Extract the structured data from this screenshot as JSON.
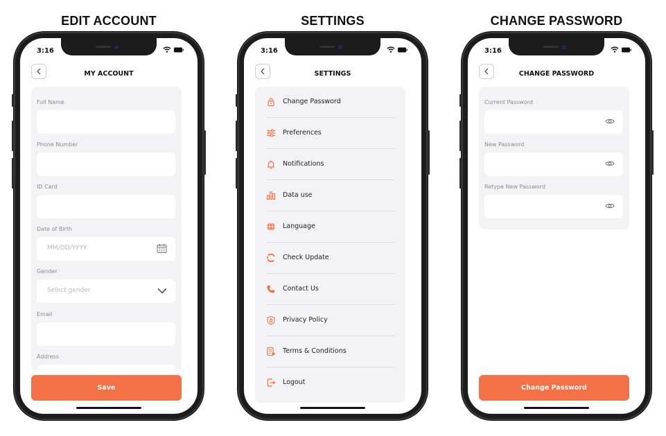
{
  "headings": [
    "EDIT ACCOUNT",
    "SETTINGS",
    "CHANGE PASSWORD"
  ],
  "status_time": "3:16",
  "accent_color": "#f47046",
  "edit_account": {
    "title": "MY ACCOUNT",
    "fields": [
      {
        "label": "Full Name",
        "placeholder": ""
      },
      {
        "label": "Phone Number",
        "placeholder": ""
      },
      {
        "label": "ID Card",
        "placeholder": ""
      },
      {
        "label": "Date of Birth",
        "placeholder": "MM/DD/YYYY",
        "icon": "calendar-icon"
      },
      {
        "label": "Gender",
        "placeholder": "Select gender",
        "icon": "chevron-down-icon"
      },
      {
        "label": "Email",
        "placeholder": ""
      },
      {
        "label": "Address",
        "placeholder": ""
      }
    ],
    "save_label": "Save"
  },
  "settings": {
    "title": "SETTINGS",
    "items": [
      {
        "label": "Change Password",
        "icon": "lock-icon"
      },
      {
        "label": "Preferences",
        "icon": "sliders-icon"
      },
      {
        "label": "Notifications",
        "icon": "bell-icon"
      },
      {
        "label": "Data use",
        "icon": "bar-chart-icon"
      },
      {
        "label": "Language",
        "icon": "globe-icon"
      },
      {
        "label": "Check Update",
        "icon": "refresh-icon"
      },
      {
        "label": "Contact Us",
        "icon": "phone-icon"
      },
      {
        "label": "Privacy Policy",
        "icon": "shield-icon"
      },
      {
        "label": "Terms & Conditions",
        "icon": "document-icon"
      },
      {
        "label": "Logout",
        "icon": "logout-icon"
      }
    ]
  },
  "change_password": {
    "title": "CHANGE PASSWORD",
    "fields": [
      {
        "label": "Current Password",
        "icon": "eye-icon"
      },
      {
        "label": "New Password",
        "icon": "eye-icon"
      },
      {
        "label": "Retype New Password",
        "icon": "eye-icon"
      }
    ],
    "button_label": "Change Password"
  }
}
